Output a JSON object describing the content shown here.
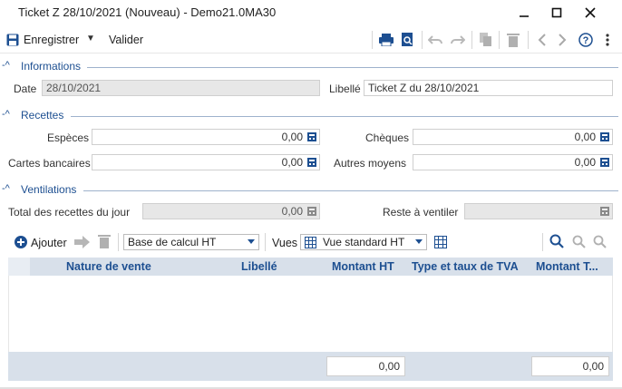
{
  "window": {
    "title": "Ticket Z 28/10/2021 (Nouveau) - Demo21.0MA30"
  },
  "toolbar": {
    "save_label": "Enregistrer",
    "validate_label": "Valider"
  },
  "informations": {
    "section_title": "Informations",
    "date_label": "Date",
    "date_value": "28/10/2021",
    "libelle_label": "Libellé",
    "libelle_value": "Ticket Z du 28/10/2021"
  },
  "recettes": {
    "section_title": "Recettes",
    "especes_label": "Espèces",
    "especes_value": "0,00",
    "cheques_label": "Chèques",
    "cheques_value": "0,00",
    "cartes_label": "Cartes bancaires",
    "cartes_value": "0,00",
    "autres_label": "Autres moyens",
    "autres_value": "0,00"
  },
  "ventilations": {
    "section_title": "Ventilations",
    "total_label": "Total des recettes du jour",
    "total_value": "0,00",
    "reste_label": "Reste à ventiler",
    "reste_value": "",
    "add_label": "Ajouter",
    "base_select": "Base de calcul HT",
    "vues_label": "Vues",
    "vues_select": "Vue standard HT",
    "columns": [
      "Nature de vente",
      "Libellé",
      "Montant HT",
      "Type et taux de TVA",
      "Montant T..."
    ],
    "total_ht": "0,00",
    "total_ttc": "0,00"
  },
  "colors": {
    "accent": "#1d4f91",
    "grid_header": "#d8e0ea"
  }
}
